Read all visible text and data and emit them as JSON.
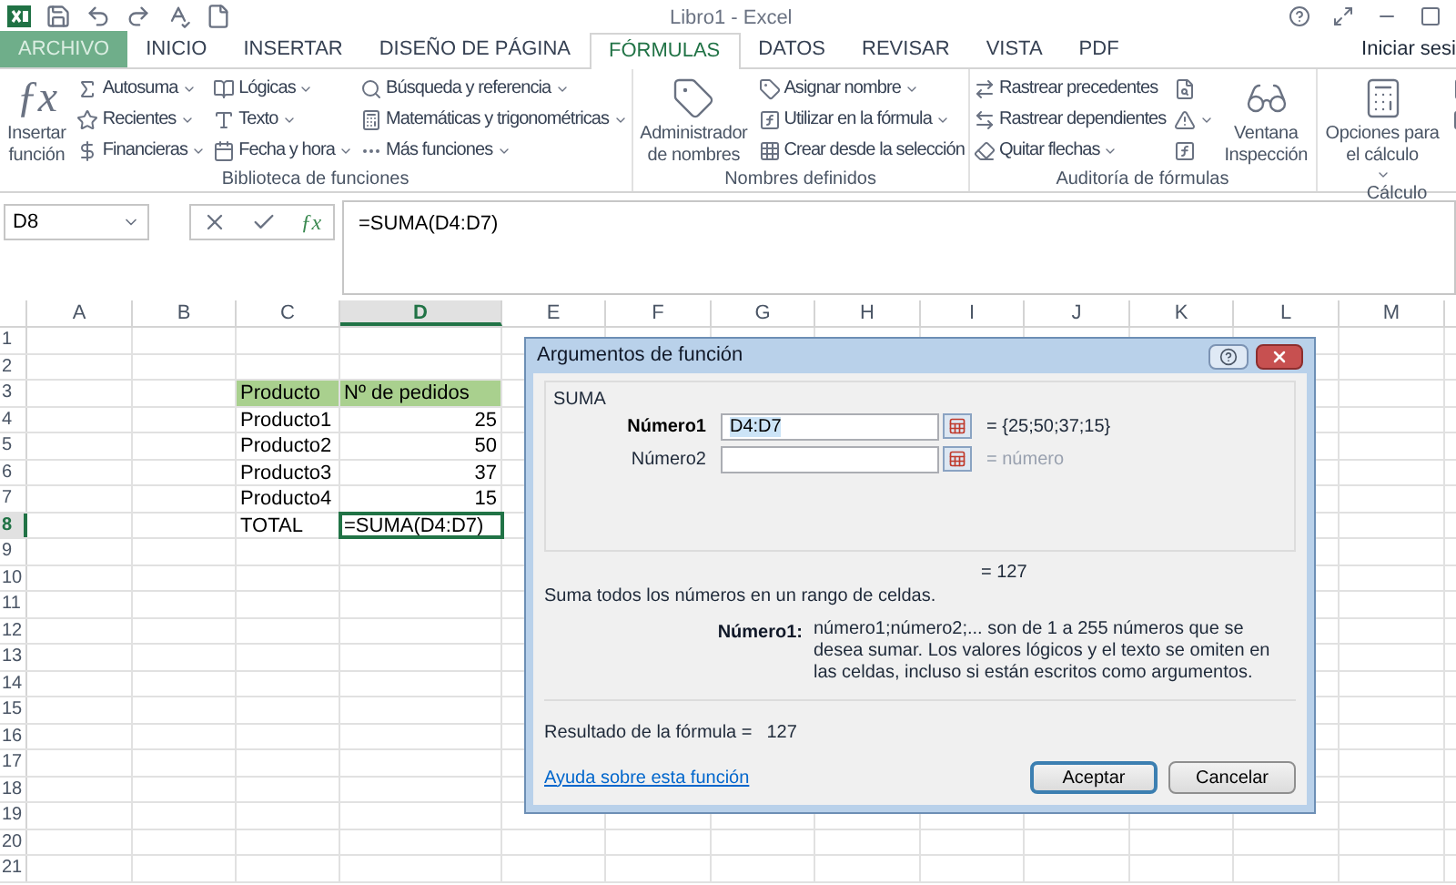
{
  "window": {
    "title": "Libro1 - Excel",
    "account": "Iniciar sesi"
  },
  "tabs": [
    {
      "label": "ARCHIVO",
      "kind": "file",
      "selected": false
    },
    {
      "label": "INICIO",
      "kind": "tab",
      "selected": false
    },
    {
      "label": "INSERTAR",
      "kind": "tab",
      "selected": false
    },
    {
      "label": "DISEÑO DE PÁGINA",
      "kind": "tab",
      "selected": false
    },
    {
      "label": "FÓRMULAS",
      "kind": "tab",
      "selected": true
    },
    {
      "label": "DATOS",
      "kind": "tab",
      "selected": false
    },
    {
      "label": "REVISAR",
      "kind": "tab",
      "selected": false
    },
    {
      "label": "VISTA",
      "kind": "tab",
      "selected": false
    },
    {
      "label": "PDF",
      "kind": "tab",
      "selected": false
    }
  ],
  "ribbon": {
    "groups": [
      {
        "label": "Biblioteca de funciones",
        "columns": [
          [
            {
              "kind": "large",
              "icon_text": "ƒx",
              "label": "Insertar función",
              "dropdown": false
            }
          ],
          [
            {
              "kind": "small",
              "label": "Autosuma",
              "dropdown": true
            },
            {
              "kind": "small",
              "label": "Recientes",
              "dropdown": true
            },
            {
              "kind": "small",
              "label": "Financieras",
              "dropdown": true
            }
          ],
          [
            {
              "kind": "small",
              "label": "Lógicas",
              "dropdown": true
            },
            {
              "kind": "small",
              "label": "Texto",
              "dropdown": true
            },
            {
              "kind": "small",
              "label": "Fecha y hora",
              "dropdown": true
            }
          ],
          [
            {
              "kind": "small",
              "label": "Búsqueda y referencia",
              "dropdown": true
            },
            {
              "kind": "small",
              "label": "Matemáticas y trigonométricas",
              "dropdown": true
            },
            {
              "kind": "small",
              "label": "Más funciones",
              "dropdown": true
            }
          ]
        ]
      },
      {
        "label": "Nombres definidos",
        "columns": [
          [
            {
              "kind": "large",
              "label": "Administrador de nombres",
              "dropdown": false
            }
          ],
          [
            {
              "kind": "small",
              "label": "Asignar nombre",
              "dropdown": true
            },
            {
              "kind": "small",
              "label": "Utilizar en la fórmula",
              "dropdown": true
            },
            {
              "kind": "small",
              "label": "Crear desde la selección",
              "dropdown": false
            }
          ]
        ]
      },
      {
        "label": "Auditoría de fórmulas",
        "columns": [
          [
            {
              "kind": "small",
              "label": "Rastrear precedentes",
              "dropdown": false
            },
            {
              "kind": "small",
              "label": "Rastrear dependientes",
              "dropdown": false
            },
            {
              "kind": "small",
              "label": "Quitar flechas",
              "dropdown": true
            }
          ],
          [
            {
              "kind": "icon",
              "dropdown": false
            },
            {
              "kind": "icon",
              "dropdown": true
            },
            {
              "kind": "icon",
              "dropdown": false
            }
          ],
          [
            {
              "kind": "large",
              "label": "Ventana Inspección",
              "dropdown": false
            }
          ]
        ]
      },
      {
        "label": "Cálculo",
        "columns": [
          [
            {
              "kind": "large",
              "label": "Opciones para el cálculo",
              "dropdown": true
            }
          ],
          [
            {
              "kind": "icon",
              "dropdown": false
            },
            {
              "kind": "icon",
              "dropdown": false
            }
          ]
        ]
      }
    ]
  },
  "formula_bar": {
    "name_box": "D8",
    "function_button": "ƒx",
    "formula": "=SUMA(D4:D7)"
  },
  "sheet": {
    "columns": [
      {
        "label": "A",
        "selected": false
      },
      {
        "label": "B",
        "selected": false
      },
      {
        "label": "C",
        "selected": false
      },
      {
        "label": "D",
        "selected": true
      },
      {
        "label": "E",
        "selected": false
      },
      {
        "label": "F",
        "selected": false
      },
      {
        "label": "G",
        "selected": false
      },
      {
        "label": "H",
        "selected": false
      },
      {
        "label": "I",
        "selected": false
      },
      {
        "label": "J",
        "selected": false
      },
      {
        "label": "K",
        "selected": false
      },
      {
        "label": "L",
        "selected": false
      },
      {
        "label": "M",
        "selected": false
      }
    ],
    "rows": [
      {
        "number": "1",
        "kind": "empty",
        "selected": false
      },
      {
        "number": "2",
        "kind": "empty",
        "selected": false
      },
      {
        "number": "3",
        "kind": "header",
        "selected": false,
        "column_c": "Producto",
        "column_d": "Nº de pedidos"
      },
      {
        "number": "4",
        "kind": "data",
        "selected": false,
        "column_c": "Producto1",
        "column_d": "25"
      },
      {
        "number": "5",
        "kind": "data",
        "selected": false,
        "column_c": "Producto2",
        "column_d": "50"
      },
      {
        "number": "6",
        "kind": "data",
        "selected": false,
        "column_c": "Producto3",
        "column_d": "37"
      },
      {
        "number": "7",
        "kind": "data",
        "selected": false,
        "column_c": "Producto4",
        "column_d": "15"
      },
      {
        "number": "8",
        "kind": "total",
        "selected": true,
        "column_c": "TOTAL",
        "column_d": "=SUMA(D4:D7)"
      },
      {
        "number": "9",
        "kind": "empty",
        "selected": false
      },
      {
        "number": "10",
        "kind": "empty",
        "selected": false
      },
      {
        "number": "11",
        "kind": "empty",
        "selected": false
      },
      {
        "number": "12",
        "kind": "empty",
        "selected": false
      },
      {
        "number": "13",
        "kind": "empty",
        "selected": false
      },
      {
        "number": "14",
        "kind": "empty",
        "selected": false
      },
      {
        "number": "15",
        "kind": "empty",
        "selected": false
      },
      {
        "number": "16",
        "kind": "empty",
        "selected": false
      },
      {
        "number": "17",
        "kind": "empty",
        "selected": false
      },
      {
        "number": "18",
        "kind": "empty",
        "selected": false
      },
      {
        "number": "19",
        "kind": "empty",
        "selected": false
      },
      {
        "number": "20",
        "kind": "empty",
        "selected": false
      },
      {
        "number": "21",
        "kind": "empty",
        "selected": false
      }
    ]
  },
  "dialog": {
    "title": "Argumentos de función",
    "function": "SUMA",
    "arguments": [
      {
        "label": "Número1",
        "value": "D4:D7",
        "result": "= {25;50;37;15}",
        "selected": true
      },
      {
        "label": "Número2",
        "placeholder_result": "= número",
        "selected": false
      }
    ],
    "total": "= 127",
    "description": "Suma todos los números en un rango de celdas.",
    "argument_help": {
      "label": "Número1:",
      "text": "número1;número2;... son de 1 a 255 números que se desea sumar. Los valores lógicos y el texto se omiten en las celdas, incluso si están escritos como argumentos."
    },
    "formula_result": {
      "label": "Resultado de la fórmula =",
      "value": "127"
    },
    "help_link": "Ayuda sobre esta función",
    "buttons": [
      {
        "label": "Aceptar",
        "default": true
      },
      {
        "label": "Cancelar",
        "default": false
      }
    ]
  }
}
